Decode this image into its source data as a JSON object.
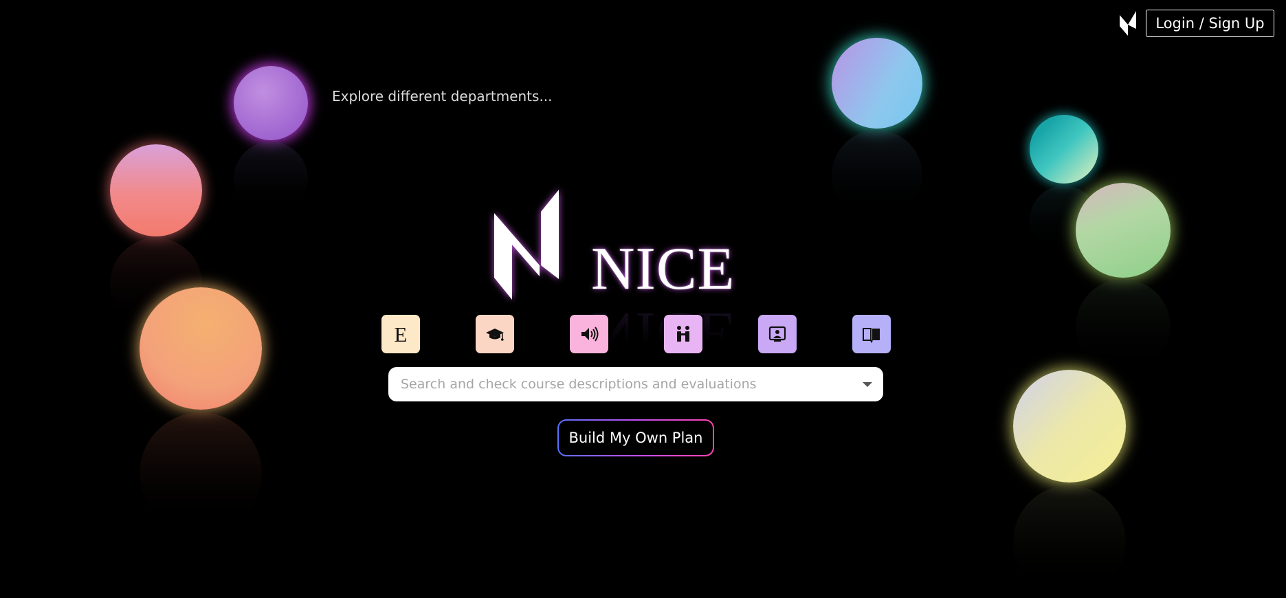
{
  "header": {
    "login_label": "Login / Sign Up"
  },
  "hero": {
    "explore_text": "Explore different departments...",
    "brand_name": "NICE"
  },
  "categories": [
    {
      "name": "E",
      "icon": "letter-e-icon",
      "color": "#fde8c8"
    },
    {
      "name": "graduation",
      "icon": "graduation-cap-icon",
      "color": "#fcd6c4"
    },
    {
      "name": "audio",
      "icon": "speaker-icon",
      "color": "#f9b3dc"
    },
    {
      "name": "people",
      "icon": "people-icon",
      "color": "#e8b4f3"
    },
    {
      "name": "presentation",
      "icon": "presentation-icon",
      "color": "#c9a8f5"
    },
    {
      "name": "book",
      "icon": "book-icon",
      "color": "#b5b0f7"
    }
  ],
  "search": {
    "placeholder": "Search and check course descriptions and evaluations"
  },
  "plan_button": {
    "label": "Build My Own Plan"
  },
  "colors": {
    "background": "#000000",
    "plan_gradient": [
      "#5a72ff",
      "#c350f0",
      "#ff43b0"
    ]
  }
}
